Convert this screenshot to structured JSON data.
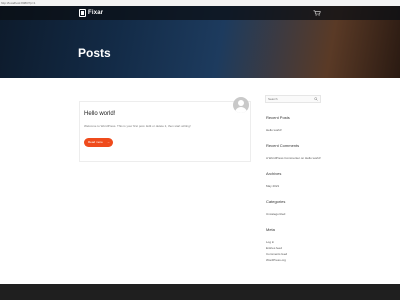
{
  "browser": {
    "url": "http://localhost:8080/?p=1"
  },
  "header": {
    "logo_text": "Fixar",
    "cart_icon": "cart-icon"
  },
  "hero": {
    "title": "Posts"
  },
  "post": {
    "title": "Hello world!",
    "excerpt": "Welcome to WordPress. This is your first post. Edit or delete it, then start writing!",
    "read_more": "Read more"
  },
  "sidebar": {
    "search_placeholder": "Search",
    "recent_posts": {
      "title": "Recent Posts",
      "items": [
        "Hello world!"
      ]
    },
    "recent_comments": {
      "title": "Recent Comments",
      "items": [
        "A WordPress Commenter on Hello world!"
      ]
    },
    "archives": {
      "title": "Archives",
      "items": [
        "May 2021"
      ]
    },
    "categories": {
      "title": "Categories",
      "items": [
        "Uncategorized"
      ]
    },
    "meta": {
      "title": "Meta",
      "items": [
        "Log in",
        "Entries feed",
        "Comments feed",
        "WordPress.org"
      ]
    }
  },
  "colors": {
    "accent": "#ef4b1c",
    "footer": "#1f1f1f"
  }
}
